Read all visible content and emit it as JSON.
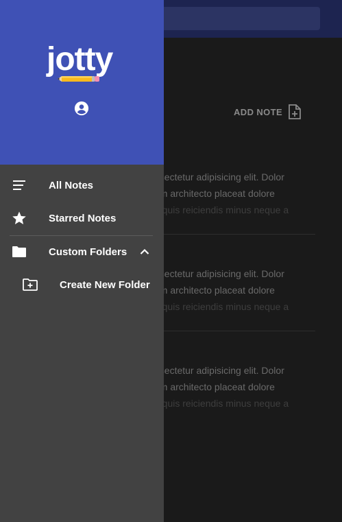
{
  "app": {
    "name": "jotty"
  },
  "toolbar": {
    "add_note_label": "ADD NOTE"
  },
  "notes": [
    {
      "lines": [
        "nsectetur adipisicing elit. Dolor",
        "em architecto placeat dolore",
        "a quis reiciendis minus neque a"
      ]
    },
    {
      "lines": [
        "nsectetur adipisicing elit. Dolor",
        "em architecto placeat dolore",
        "a quis reiciendis minus neque a"
      ]
    },
    {
      "lines": [
        "nsectetur adipisicing elit. Dolor",
        "em architecto placeat dolore",
        "a quis reiciendis minus neque a"
      ]
    }
  ],
  "drawer": {
    "items": [
      {
        "label": "All Notes",
        "icon": "list-icon"
      },
      {
        "label": "Starred Notes",
        "icon": "star-icon"
      },
      {
        "label": "Custom Folders",
        "icon": "folder-icon",
        "expanded": true
      },
      {
        "label": "Create New Folder",
        "icon": "create-folder-icon"
      }
    ]
  },
  "colors": {
    "primary": "#3f51b5",
    "drawer_bg": "#424242",
    "background": "#1a1a1a",
    "pencil_yellow": "#f9b91e"
  }
}
